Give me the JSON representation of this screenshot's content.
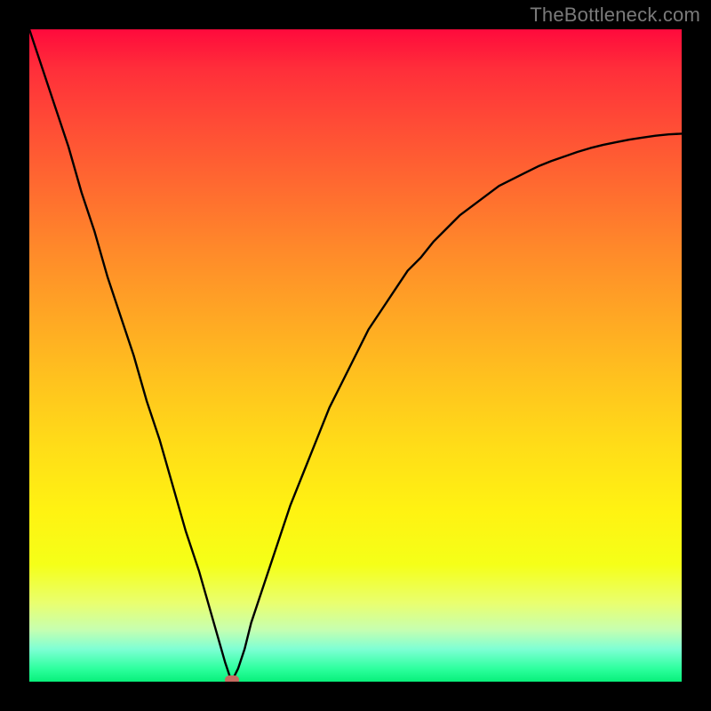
{
  "watermark": "TheBottleneck.com",
  "chart_data": {
    "type": "line",
    "title": "",
    "xlabel": "",
    "ylabel": "",
    "xlim": [
      0,
      100
    ],
    "ylim": [
      0,
      100
    ],
    "grid": false,
    "x": [
      0,
      2,
      4,
      6,
      8,
      10,
      12,
      14,
      16,
      18,
      20,
      22,
      24,
      26,
      28,
      30,
      31,
      32,
      33,
      34,
      36,
      38,
      40,
      42,
      44,
      46,
      48,
      50,
      52,
      54,
      56,
      58,
      60,
      62,
      64,
      66,
      68,
      70,
      72,
      74,
      76,
      78,
      80,
      82,
      84,
      86,
      88,
      90,
      92,
      94,
      96,
      98,
      100
    ],
    "values": [
      100,
      94,
      88,
      82,
      75,
      69,
      62,
      56,
      50,
      43,
      37,
      30,
      23,
      17,
      10,
      3,
      0,
      2,
      5,
      9,
      15,
      21,
      27,
      32,
      37,
      42,
      46,
      50,
      54,
      57,
      60,
      63,
      65,
      67.5,
      69.5,
      71.5,
      73,
      74.5,
      76,
      77,
      78,
      79,
      79.8,
      80.5,
      81.2,
      81.8,
      82.3,
      82.7,
      83.1,
      83.4,
      83.7,
      83.9,
      84
    ],
    "marker": {
      "x": 31,
      "y": 0
    },
    "colors": {
      "background_top": "#ff0a3c",
      "background_bottom": "#08f07a",
      "curve": "#000000",
      "marker": "#c66a60",
      "frame": "#000000"
    }
  }
}
